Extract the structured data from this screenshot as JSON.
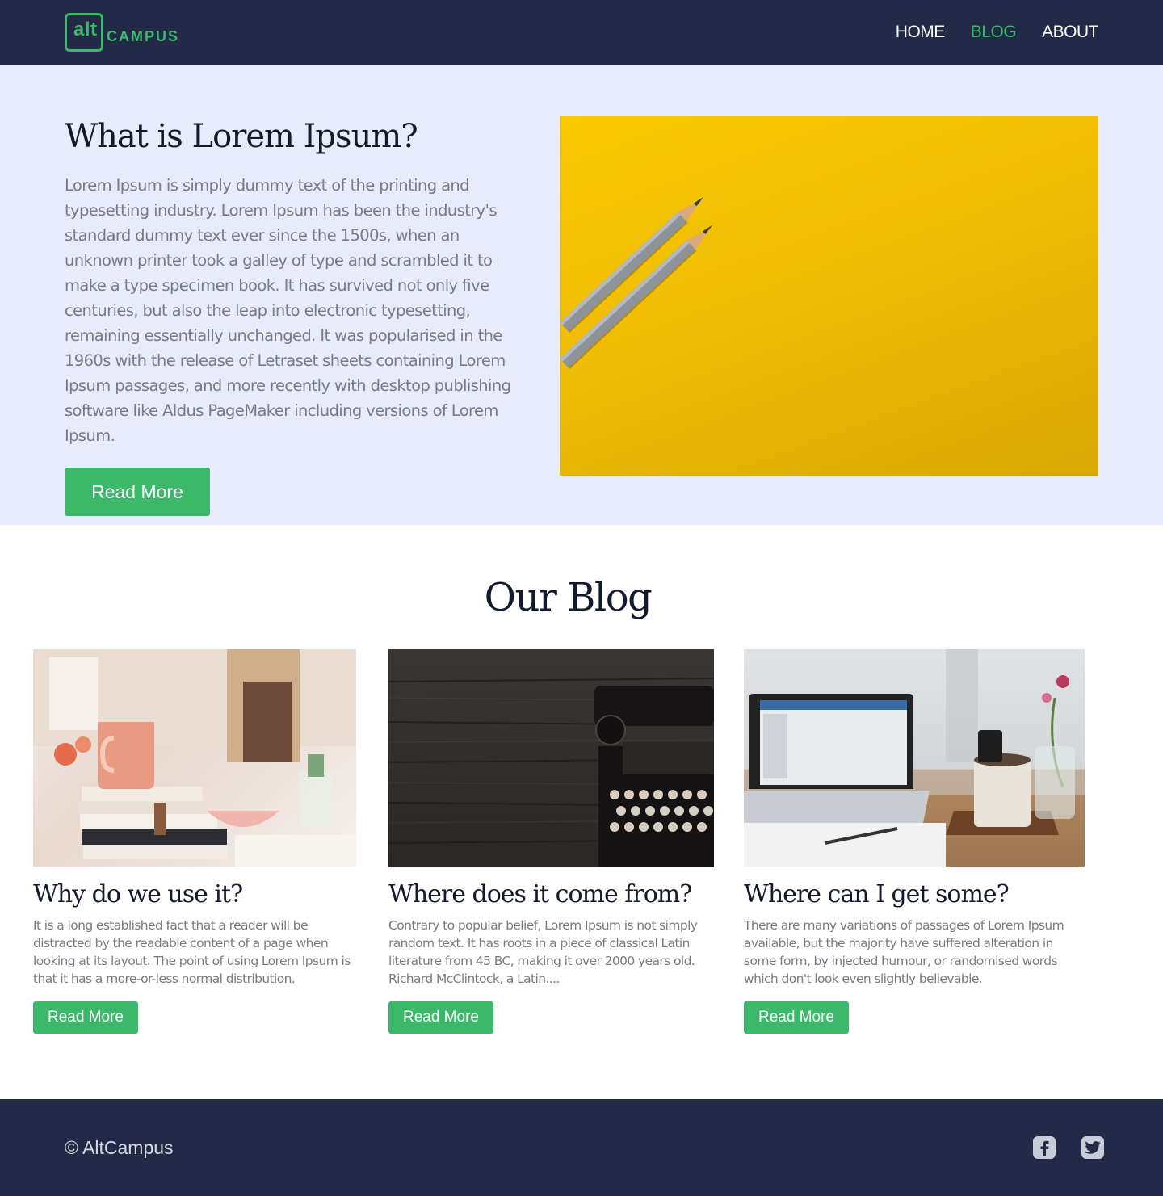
{
  "brand": {
    "logo_mark": "alt",
    "logo_word": "CAMPUS",
    "accent": "#3cb86a",
    "navy": "#222a47"
  },
  "nav": {
    "items": [
      {
        "label": "HOME",
        "active": false
      },
      {
        "label": "BLOG",
        "active": true
      },
      {
        "label": "ABOUT",
        "active": false
      }
    ]
  },
  "hero": {
    "title": "What is Lorem Ipsum?",
    "text": "Lorem Ipsum is simply dummy text of the printing and typesetting industry. Lorem Ipsum has been the industry's standard dummy text ever since the 1500s, when an unknown printer took a galley of type and scrambled it to make a type specimen book. It has survived not only five centuries, but also the leap into electronic typesetting, remaining essentially unchanged. It was popularised in the 1960s with the release of Letraset sheets containing Lorem Ipsum passages, and more recently with desktop publishing software like Aldus PageMaker including versions of Lorem Ipsum.",
    "button": "Read More",
    "image": "pencils-on-yellow-background"
  },
  "blog": {
    "title": "Our Blog",
    "cards": [
      {
        "title": "Why do we use it?",
        "text": "It is a long established fact that a reader will be distracted by the readable content of a page when looking at its layout. The point of using Lorem Ipsum is that it has a more-or-less normal distribution.",
        "button": "Read More",
        "image": "pink-mug-on-books"
      },
      {
        "title": "Where does it come from?",
        "text": "Contrary to popular belief, Lorem Ipsum is not simply random text. It has roots in a piece of classical Latin literature from 45 BC, making it over 2000 years old. Richard McClintock, a Latin....",
        "button": "Read More",
        "image": "typewriter-on-dark-wood"
      },
      {
        "title": "Where can I get some?",
        "text": "There are many variations of passages of Lorem Ipsum available, but the majority have suffered alteration in some form, by injected humour, or randomised words which don't look even slightly believable.",
        "button": "Read More",
        "image": "laptop-on-desk-with-flowers"
      }
    ]
  },
  "footer": {
    "copyright": "© AltCampus",
    "socials": [
      "facebook-icon",
      "twitter-icon"
    ]
  }
}
